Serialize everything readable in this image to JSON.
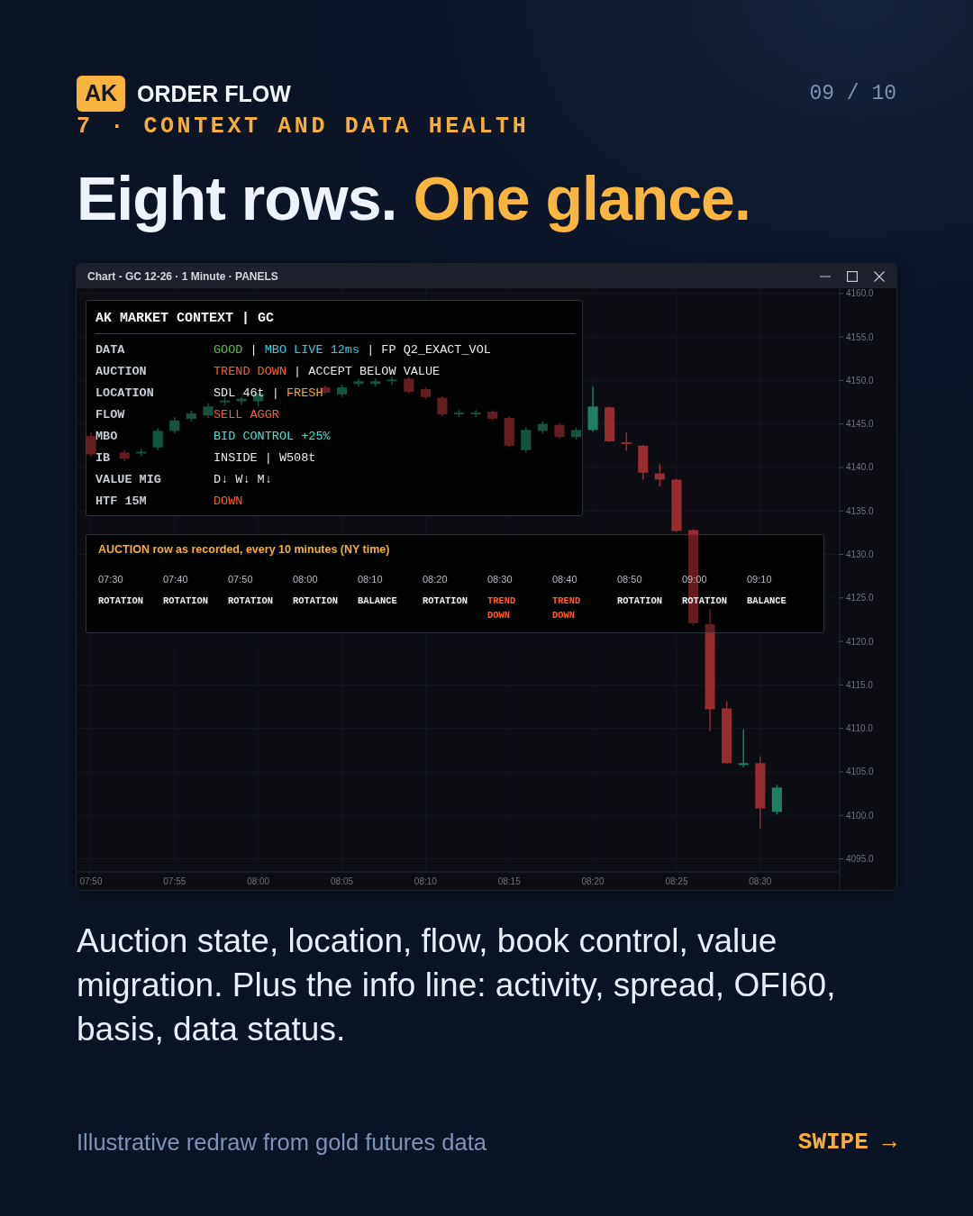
{
  "header": {
    "badge": "AK",
    "brand": "ORDER FLOW",
    "page": "09 / 10",
    "section": "7 · CONTEXT AND DATA HEALTH"
  },
  "headline": [
    {
      "text": "Eight rows.",
      "kind": "plain"
    },
    {
      "text": "One glance.",
      "kind": "accent"
    }
  ],
  "chart_window": {
    "title": "Chart - GC 12-26 · 1 Minute · PANELS",
    "chart_data": {
      "type": "candlestick",
      "grid": true,
      "x": [
        470,
        472,
        473,
        474,
        475,
        476,
        477,
        478,
        479,
        480,
        484,
        485,
        486,
        487,
        488,
        489,
        490,
        491,
        492,
        493,
        494,
        495,
        496,
        497,
        498,
        499,
        500,
        501,
        502,
        503,
        504,
        505,
        506,
        507,
        508,
        509,
        510,
        511
      ],
      "ohlc": [
        [
          4143.6,
          4144.0,
          4141.2,
          4141.5
        ],
        [
          4141.7,
          4142.0,
          4140.7,
          4141.0
        ],
        [
          4141.6,
          4142.1,
          4141.3,
          4141.8
        ],
        [
          4142.3,
          4144.5,
          4142.0,
          4144.2
        ],
        [
          4144.2,
          4145.8,
          4143.9,
          4145.4
        ],
        [
          4145.6,
          4146.5,
          4145.3,
          4146.2
        ],
        [
          4146.0,
          4147.4,
          4145.7,
          4147.0
        ],
        [
          4147.5,
          4148.1,
          4147.1,
          4147.7
        ],
        [
          4147.6,
          4148.1,
          4147.2,
          4147.9
        ],
        [
          4147.6,
          4148.5,
          4147.0,
          4148.5
        ],
        [
          4149.2,
          4149.4,
          4148.4,
          4148.6
        ],
        [
          4148.4,
          4149.5,
          4148.1,
          4149.2
        ],
        [
          4149.6,
          4150.2,
          4149.3,
          4149.9
        ],
        [
          4149.6,
          4150.2,
          4149.3,
          4149.9
        ],
        [
          4149.9,
          4150.4,
          4149.5,
          4150.1
        ],
        [
          4150.2,
          4150.4,
          4148.5,
          4148.7
        ],
        [
          4149.0,
          4149.2,
          4147.9,
          4148.1
        ],
        [
          4148.0,
          4148.2,
          4145.9,
          4146.1
        ],
        [
          4146.1,
          4146.6,
          4145.8,
          4146.3
        ],
        [
          4146.1,
          4146.6,
          4145.8,
          4146.3
        ],
        [
          4146.4,
          4146.6,
          4145.4,
          4145.6
        ],
        [
          4145.7,
          4145.9,
          4142.3,
          4142.5
        ],
        [
          4142.0,
          4144.6,
          4141.7,
          4144.3
        ],
        [
          4144.2,
          4145.3,
          4143.9,
          4145.0
        ],
        [
          4144.9,
          4145.1,
          4143.3,
          4143.5
        ],
        [
          4143.5,
          4144.6,
          4143.2,
          4144.3
        ],
        [
          4144.3,
          4149.3,
          4144.1,
          4147.0
        ],
        [
          4146.9,
          4147.0,
          4142.9,
          4143.0
        ],
        [
          4142.9,
          4144.0,
          4141.9,
          4142.7
        ],
        [
          4142.5,
          4142.6,
          4138.6,
          4139.4
        ],
        [
          4139.3,
          4140.4,
          4137.8,
          4138.6
        ],
        [
          4138.6,
          4138.7,
          4132.6,
          4132.7
        ],
        [
          4132.8,
          4132.9,
          4121.8,
          4122.1
        ],
        [
          4122.0,
          4123.7,
          4109.7,
          4112.2
        ],
        [
          4112.3,
          4113.1,
          4105.9,
          4106.0
        ],
        [
          4105.8,
          4109.9,
          4105.5,
          4106.0
        ],
        [
          4106.0,
          4106.8,
          4098.5,
          4100.8
        ],
        [
          4100.4,
          4103.5,
          4100.1,
          4103.2
        ]
      ],
      "xlim": [
        469.14,
        514.75
      ],
      "ylim": [
        4093.5,
        4160.6
      ],
      "xticks": [
        {
          "value": 470,
          "label": "07:50"
        },
        {
          "value": 475,
          "label": "07:55"
        },
        {
          "value": 480,
          "label": "08:00"
        },
        {
          "value": 485,
          "label": "08:05"
        },
        {
          "value": 490,
          "label": "08:10"
        },
        {
          "value": 495,
          "label": "08:15"
        },
        {
          "value": 500,
          "label": "08:20"
        },
        {
          "value": 505,
          "label": "08:25"
        },
        {
          "value": 510,
          "label": "08:30"
        }
      ],
      "yticks": [
        {
          "value": 4160,
          "label": "4160.0"
        },
        {
          "value": 4155,
          "label": "4155.0"
        },
        {
          "value": 4150,
          "label": "4150.0"
        },
        {
          "value": 4145,
          "label": "4145.0"
        },
        {
          "value": 4140,
          "label": "4140.0"
        },
        {
          "value": 4135,
          "label": "4135.0"
        },
        {
          "value": 4130,
          "label": "4130.0"
        },
        {
          "value": 4125,
          "label": "4125.0"
        },
        {
          "value": 4120,
          "label": "4120.0"
        },
        {
          "value": 4115,
          "label": "4115.0"
        },
        {
          "value": 4110,
          "label": "4110.0"
        },
        {
          "value": 4105,
          "label": "4105.0"
        },
        {
          "value": 4100,
          "label": "4100.0"
        },
        {
          "value": 4095,
          "label": "4095.0"
        }
      ]
    },
    "context_panel": {
      "title": "AK MARKET CONTEXT | GC",
      "rows": [
        {
          "label": "DATA",
          "value": [
            {
              "text": "GOOD",
              "kind": "good"
            },
            {
              "text": " | ",
              "kind": "plain"
            },
            {
              "text": "MBO LIVE 12ms",
              "kind": "live"
            },
            {
              "text": " | FP Q2_EXACT_VOL",
              "kind": "plain"
            }
          ]
        },
        {
          "label": "AUCTION",
          "value": [
            {
              "text": "TREND DOWN",
              "kind": "bear"
            },
            {
              "text": " | ACCEPT BELOW VALUE",
              "kind": "plain"
            }
          ]
        },
        {
          "label": "LOCATION",
          "value": [
            {
              "text": "SDL 46t | ",
              "kind": "plain"
            },
            {
              "text": "FRESH",
              "kind": "fresh"
            }
          ]
        },
        {
          "label": "FLOW",
          "value": [
            {
              "text": "SELL AGGR",
              "kind": "bear"
            }
          ]
        },
        {
          "label": "MBO",
          "value": [
            {
              "text": "BID CONTROL +25%",
              "kind": "bid"
            }
          ]
        },
        {
          "label": "IB",
          "value": [
            {
              "text": "INSIDE | W508t",
              "kind": "plain"
            }
          ]
        },
        {
          "label": "VALUE MIG",
          "value": [
            {
              "text": "D↓ W↓ M↓",
              "kind": "plain"
            }
          ]
        },
        {
          "label": "HTF 15M",
          "value": [
            {
              "text": "DOWN",
              "kind": "bear"
            }
          ]
        }
      ]
    },
    "auction_panel": {
      "title": "AUCTION row as recorded, every 10 minutes (NY time)",
      "slots": [
        {
          "time": "07:30",
          "state": "ROTATION",
          "kind": "rotation"
        },
        {
          "time": "07:40",
          "state": "ROTATION",
          "kind": "rotation"
        },
        {
          "time": "07:50",
          "state": "ROTATION",
          "kind": "rotation"
        },
        {
          "time": "08:00",
          "state": "ROTATION",
          "kind": "rotation"
        },
        {
          "time": "08:10",
          "state": "BALANCE",
          "kind": "balance"
        },
        {
          "time": "08:20",
          "state": "ROTATION",
          "kind": "rotation"
        },
        {
          "time": "08:30",
          "state": "TREND DOWN",
          "kind": "trend"
        },
        {
          "time": "08:40",
          "state": "TREND DOWN",
          "kind": "trend"
        },
        {
          "time": "08:50",
          "state": "ROTATION",
          "kind": "rotation"
        },
        {
          "time": "09:00",
          "state": "ROTATION",
          "kind": "rotation"
        },
        {
          "time": "09:10",
          "state": "BALANCE",
          "kind": "balance"
        }
      ]
    }
  },
  "description": "Auction state, location, flow, book control, value migration. Plus the info line: activity, spread, OFI60, basis, data status.",
  "footer": {
    "note": "Illustrative redraw from gold futures data",
    "swipe": "SWIPE →"
  }
}
